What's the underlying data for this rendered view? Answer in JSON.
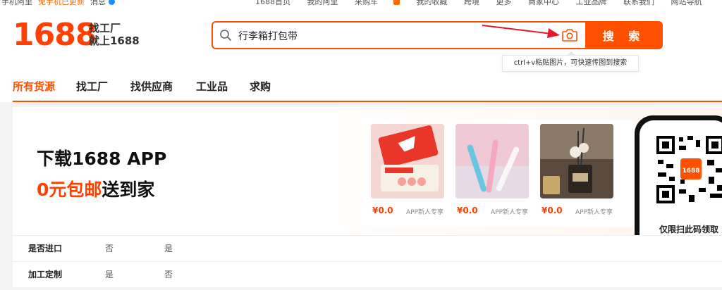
{
  "topbar": {
    "left_a": "手机阿里",
    "left_b": "免手机已更新",
    "left_c": "消息",
    "right_items": [
      "1688首页",
      "我的阿里",
      "采购车",
      "我的收藏",
      "跨境",
      "更多",
      "商家中心",
      "工业品牌",
      "联系我们",
      "网站导航"
    ]
  },
  "header": {
    "logo": "1688",
    "slogan_line1": "找工厂",
    "slogan_line2": "就上1688"
  },
  "search": {
    "value": "行李箱打包带",
    "button": "搜 索",
    "tooltip": "ctrl+v粘贴图片，可快速传图到搜索"
  },
  "nav": {
    "items": [
      "所有货源",
      "找工厂",
      "找供应商",
      "工业品",
      "求购"
    ],
    "active_index": 0
  },
  "banner": {
    "title": "下载1688 APP",
    "sub_highlight": "0元包邮",
    "sub_rest": "送到家",
    "products": [
      {
        "price": "¥0.0",
        "tag": "APP新人专享"
      },
      {
        "price": "¥0.0",
        "tag": "APP新人专享"
      },
      {
        "price": "¥0.0",
        "tag": "APP新人专享"
      }
    ],
    "qr_caption": "仅限扫此码领取"
  },
  "filters": [
    {
      "label": "是否进口",
      "options": [
        "否",
        "是"
      ]
    },
    {
      "label": "加工定制",
      "options": [
        "是",
        "否"
      ]
    }
  ],
  "colors": {
    "brand": "#ff5000",
    "accent": "#ff4000"
  }
}
